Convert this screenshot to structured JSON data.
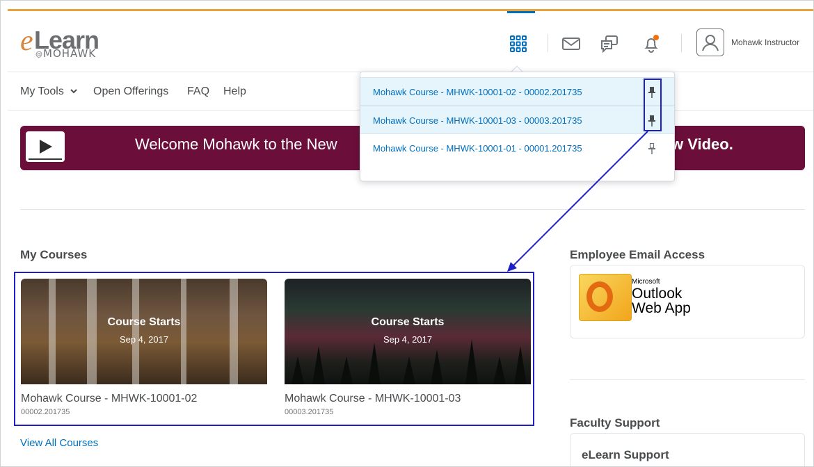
{
  "logo": {
    "e": "e",
    "learn": "Learn",
    "sub_at": "@",
    "sub": "MOHAWK"
  },
  "header": {
    "icons": [
      "grid-icon",
      "mail-icon",
      "chat-icon",
      "bell-icon"
    ],
    "notification_dot_color": "#f3700b",
    "user_name": "Mohawk Instructor"
  },
  "nav": {
    "items": [
      "My Tools",
      "Open Offerings",
      "FAQ",
      "Help"
    ]
  },
  "banner": {
    "text_left": "Welcome Mohawk to the New",
    "text_right": "w Video.",
    "color": "#6b0f3a"
  },
  "course_selector": {
    "items": [
      {
        "label": "Mohawk Course - MHWK-10001-02 - 00002.201735",
        "pinned": true
      },
      {
        "label": "Mohawk Course - MHWK-10001-03 - 00003.201735",
        "pinned": true
      },
      {
        "label": "Mohawk Course - MHWK-10001-01 - 00001.201735",
        "pinned": false
      }
    ]
  },
  "my_courses": {
    "title": "My Courses",
    "courses": [
      {
        "overlay_title": "Course Starts",
        "overlay_date": "Sep 4, 2017",
        "name": "Mohawk Course - MHWK-10001-02",
        "code": "00002.201735"
      },
      {
        "overlay_title": "Course Starts",
        "overlay_date": "Sep 4, 2017",
        "name": "Mohawk Course - MHWK-10001-03",
        "code": "00003.201735"
      }
    ],
    "view_all": "View All Courses"
  },
  "employee_email": {
    "title": "Employee Email Access",
    "owa_small": "Microsoft",
    "owa_line1": "Outlook",
    "owa_line2": "Web App"
  },
  "faculty_support": {
    "title": "Faculty Support",
    "item": "eLearn Support"
  },
  "colors": {
    "accent": "#006fbf",
    "top_stripe": "#e8a33a",
    "annotation": "#1f1fc7"
  }
}
